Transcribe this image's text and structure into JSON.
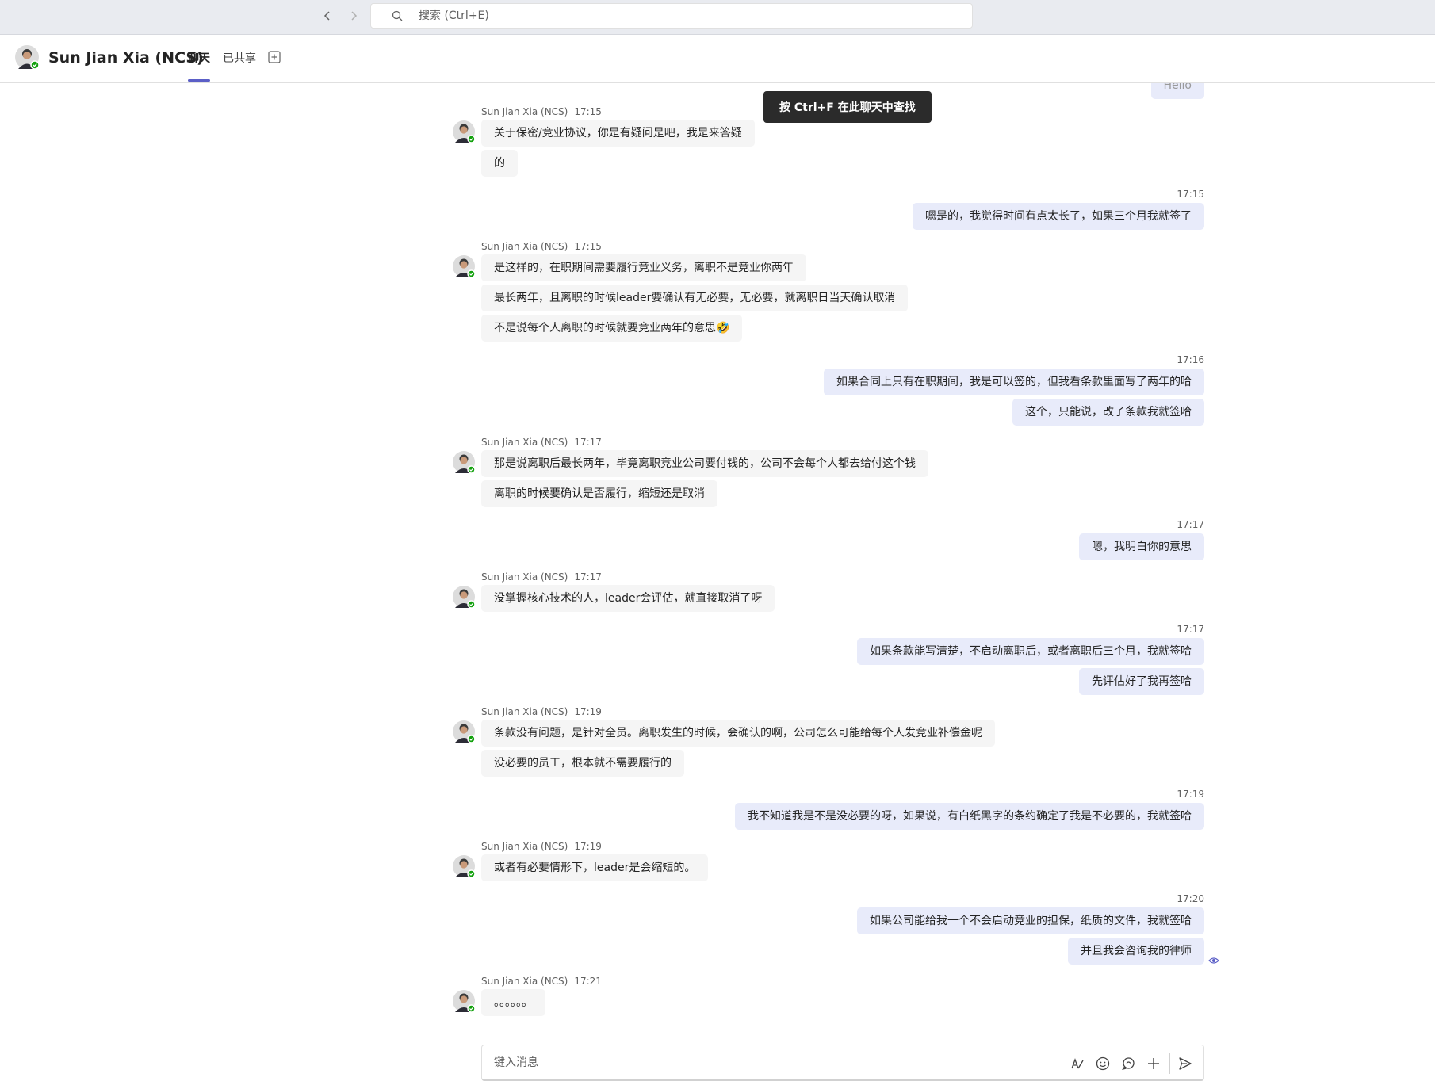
{
  "search": {
    "placeholder": "搜索 (Ctrl+E)"
  },
  "header": {
    "contact_name": "Sun Jian Xia (NCS)",
    "tabs": [
      {
        "label": "聊天"
      },
      {
        "label": "已共享"
      }
    ]
  },
  "tooltip": "按 Ctrl+F 在此聊天中查找",
  "partial_top_bubble": "Hello",
  "groups": [
    {
      "sender": "Sun Jian Xia (NCS)",
      "time": "17:15",
      "messages": [
        "关于保密/竞业协议，你是有疑问是吧，我是来答疑",
        "的"
      ]
    },
    {
      "time": "17:15",
      "messages": [
        "嗯是的，我觉得时间有点太长了，如果三个月我就签了"
      ]
    },
    {
      "sender": "Sun Jian Xia (NCS)",
      "time": "17:15",
      "messages": [
        "是这样的，在职期间需要履行竞业义务，离职不是竞业你两年",
        "最长两年，且离职的时候leader要确认有无必要，无必要，就离职日当天确认取消",
        "不是说每个人离职的时候就要竞业两年的意思🤣"
      ]
    },
    {
      "time": "17:16",
      "messages": [
        "如果合同上只有在职期间，我是可以签的，但我看条款里面写了两年的哈",
        "这个，只能说，改了条款我就签哈"
      ]
    },
    {
      "sender": "Sun Jian Xia (NCS)",
      "time": "17:17",
      "messages": [
        "那是说离职后最长两年，毕竟离职竞业公司要付钱的，公司不会每个人都去给付这个钱",
        "离职的时候要确认是否履行，缩短还是取消"
      ]
    },
    {
      "time": "17:17",
      "messages": [
        "嗯，我明白你的意思"
      ]
    },
    {
      "sender": "Sun Jian Xia (NCS)",
      "time": "17:17",
      "messages": [
        "没掌握核心技术的人，leader会评估，就直接取消了呀"
      ]
    },
    {
      "time": "17:17",
      "messages": [
        "如果条款能写清楚，不启动离职后，或者离职后三个月，我就签哈",
        "先评估好了我再签哈"
      ]
    },
    {
      "sender": "Sun Jian Xia (NCS)",
      "time": "17:19",
      "messages": [
        "条款没有问题，是针对全员。离职发生的时候，会确认的啊，公司怎么可能给每个人发竞业补偿金呢",
        "没必要的员工，根本就不需要履行的"
      ]
    },
    {
      "time": "17:19",
      "messages": [
        "我不知道我是不是没必要的呀，如果说，有白纸黑字的条约确定了我是不必要的，我就签哈"
      ]
    },
    {
      "sender": "Sun Jian Xia (NCS)",
      "time": "17:19",
      "messages": [
        "或者有必要情形下，leader是会缩短的。"
      ]
    },
    {
      "time": "17:20",
      "messages": [
        "如果公司能给我一个不会启动竞业的担保，纸质的文件，我就签哈",
        "并且我会咨询我的律师"
      ]
    },
    {
      "sender": "Sun Jian Xia (NCS)",
      "time": "17:21",
      "messages": [
        "。。。。。。"
      ]
    }
  ],
  "compose": {
    "placeholder": "键入消息"
  },
  "colors": {
    "accent": "#5b5fc7",
    "incoming_bubble": "#f5f5f5",
    "outgoing_bubble": "#e8ebfa",
    "presence": "#13a10e"
  }
}
